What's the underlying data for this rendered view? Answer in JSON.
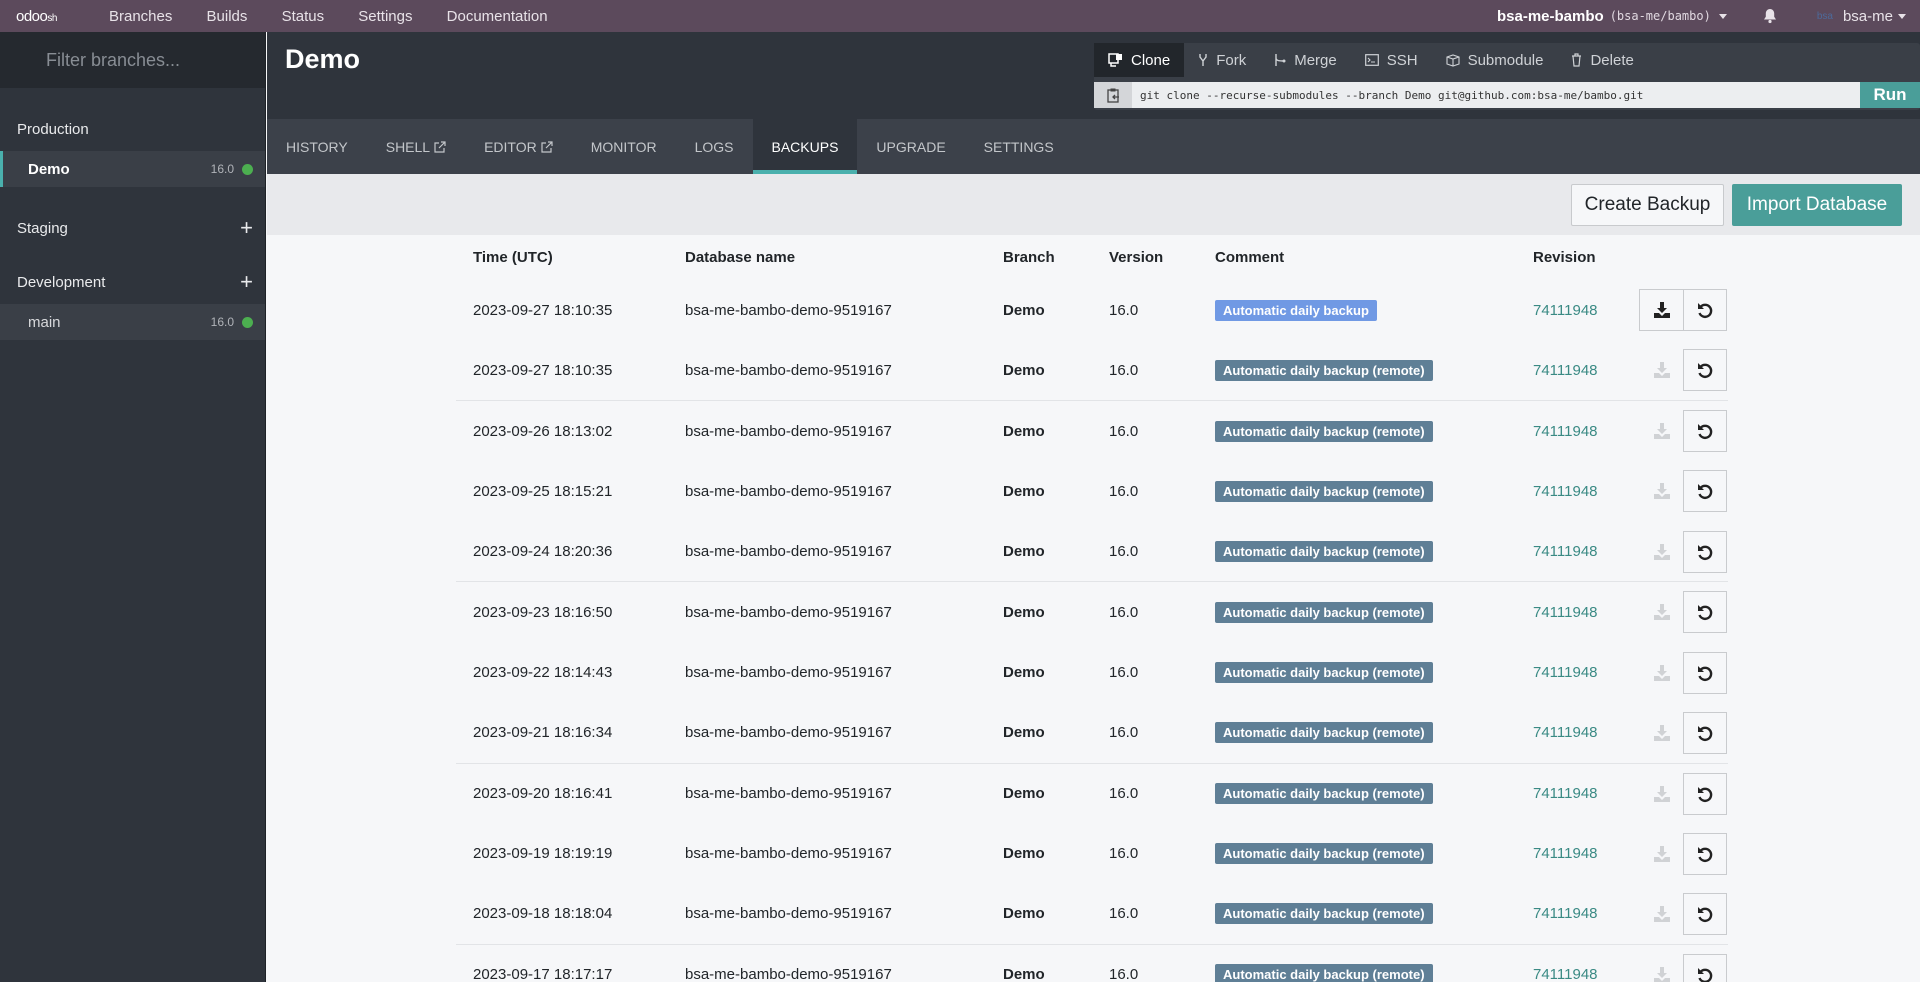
{
  "topbar": {
    "logo": "odoo",
    "logo_suffix": "sh",
    "nav": [
      "Branches",
      "Builds",
      "Status",
      "Settings",
      "Documentation"
    ],
    "project_name": "bsa-me-bambo",
    "project_repo": "(bsa-me/bambo)",
    "user_avatar_text": "bsa",
    "user_name": "bsa-me"
  },
  "sidebar": {
    "filter_placeholder": "Filter branches...",
    "sections": [
      {
        "title": "Production",
        "can_add": false,
        "branches": [
          {
            "name": "Demo",
            "version": "16.0",
            "status_color": "#4caf50",
            "active": true
          }
        ]
      },
      {
        "title": "Staging",
        "can_add": true,
        "branches": []
      },
      {
        "title": "Development",
        "can_add": true,
        "branches": [
          {
            "name": "main",
            "version": "16.0",
            "status_color": "#4caf50",
            "active": false
          }
        ]
      }
    ]
  },
  "header": {
    "title": "Demo",
    "git_tabs": [
      {
        "label": "Clone",
        "icon": "clone-icon",
        "active": true
      },
      {
        "label": "Fork",
        "icon": "fork-icon",
        "active": false
      },
      {
        "label": "Merge",
        "icon": "merge-icon",
        "active": false
      },
      {
        "label": "SSH",
        "icon": "terminal-icon",
        "active": false
      },
      {
        "label": "Submodule",
        "icon": "cube-icon",
        "active": false
      },
      {
        "label": "Delete",
        "icon": "trash-icon",
        "active": false
      }
    ],
    "command": "git clone --recurse-submodules --branch Demo git@github.com:bsa-me/bambo.git",
    "run_label": "Run"
  },
  "tabs": [
    {
      "label": "HISTORY",
      "external": false,
      "active": false
    },
    {
      "label": "SHELL",
      "external": true,
      "active": false
    },
    {
      "label": "EDITOR",
      "external": true,
      "active": false
    },
    {
      "label": "MONITOR",
      "external": false,
      "active": false
    },
    {
      "label": "LOGS",
      "external": false,
      "active": false
    },
    {
      "label": "BACKUPS",
      "external": false,
      "active": true
    },
    {
      "label": "UPGRADE",
      "external": false,
      "active": false
    },
    {
      "label": "SETTINGS",
      "external": false,
      "active": false
    }
  ],
  "actions": {
    "create_backup": "Create Backup",
    "import_database": "Import Database"
  },
  "colors": {
    "accent": "#4a9e99",
    "topbar": "#5c4a5c",
    "badge_local": "#7099e4",
    "badge_remote": "#5f7f96"
  },
  "backups": {
    "columns": [
      "Time (UTC)",
      "Database name",
      "Branch",
      "Version",
      "Comment",
      "Revision"
    ],
    "rows": [
      {
        "time": "2023-09-27 18:10:35",
        "db": "bsa-me-bambo-demo-9519167",
        "branch": "Demo",
        "version": "16.0",
        "comment": "Automatic daily backup",
        "remote": false,
        "revision": "74111948",
        "downloadable": true
      },
      {
        "time": "2023-09-27 18:10:35",
        "db": "bsa-me-bambo-demo-9519167",
        "branch": "Demo",
        "version": "16.0",
        "comment": "Automatic daily backup (remote)",
        "remote": true,
        "revision": "74111948",
        "downloadable": false
      },
      {
        "time": "2023-09-26 18:13:02",
        "db": "bsa-me-bambo-demo-9519167",
        "branch": "Demo",
        "version": "16.0",
        "comment": "Automatic daily backup (remote)",
        "remote": true,
        "revision": "74111948",
        "downloadable": false
      },
      {
        "time": "2023-09-25 18:15:21",
        "db": "bsa-me-bambo-demo-9519167",
        "branch": "Demo",
        "version": "16.0",
        "comment": "Automatic daily backup (remote)",
        "remote": true,
        "revision": "74111948",
        "downloadable": false
      },
      {
        "time": "2023-09-24 18:20:36",
        "db": "bsa-me-bambo-demo-9519167",
        "branch": "Demo",
        "version": "16.0",
        "comment": "Automatic daily backup (remote)",
        "remote": true,
        "revision": "74111948",
        "downloadable": false
      },
      {
        "time": "2023-09-23 18:16:50",
        "db": "bsa-me-bambo-demo-9519167",
        "branch": "Demo",
        "version": "16.0",
        "comment": "Automatic daily backup (remote)",
        "remote": true,
        "revision": "74111948",
        "downloadable": false
      },
      {
        "time": "2023-09-22 18:14:43",
        "db": "bsa-me-bambo-demo-9519167",
        "branch": "Demo",
        "version": "16.0",
        "comment": "Automatic daily backup (remote)",
        "remote": true,
        "revision": "74111948",
        "downloadable": false
      },
      {
        "time": "2023-09-21 18:16:34",
        "db": "bsa-me-bambo-demo-9519167",
        "branch": "Demo",
        "version": "16.0",
        "comment": "Automatic daily backup (remote)",
        "remote": true,
        "revision": "74111948",
        "downloadable": false
      },
      {
        "time": "2023-09-20 18:16:41",
        "db": "bsa-me-bambo-demo-9519167",
        "branch": "Demo",
        "version": "16.0",
        "comment": "Automatic daily backup (remote)",
        "remote": true,
        "revision": "74111948",
        "downloadable": false
      },
      {
        "time": "2023-09-19 18:19:19",
        "db": "bsa-me-bambo-demo-9519167",
        "branch": "Demo",
        "version": "16.0",
        "comment": "Automatic daily backup (remote)",
        "remote": true,
        "revision": "74111948",
        "downloadable": false
      },
      {
        "time": "2023-09-18 18:18:04",
        "db": "bsa-me-bambo-demo-9519167",
        "branch": "Demo",
        "version": "16.0",
        "comment": "Automatic daily backup (remote)",
        "remote": true,
        "revision": "74111948",
        "downloadable": false
      },
      {
        "time": "2023-09-17 18:17:17",
        "db": "bsa-me-bambo-demo-9519167",
        "branch": "Demo",
        "version": "16.0",
        "comment": "Automatic daily backup (remote)",
        "remote": true,
        "revision": "74111948",
        "downloadable": false
      }
    ]
  }
}
